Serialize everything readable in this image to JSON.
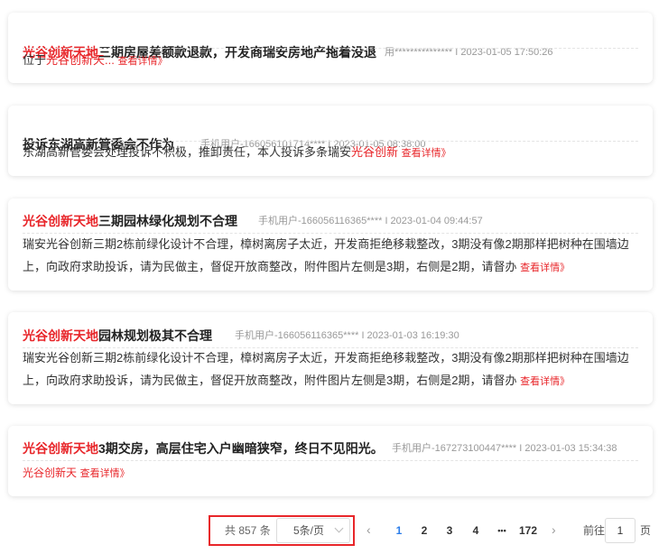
{
  "posts": [
    {
      "title_hl": "光谷创新天地",
      "title_rest": "三期房屋差额款退款，开发商瑞安房地产拖着没退",
      "meta": "用*************** I 2023-01-05 17:50:26",
      "body_text": "位于",
      "body_hl": "光谷创新天...",
      "more": "查看详情》"
    },
    {
      "title_hl": "",
      "title_rest": "投诉东湖高新管委会不作为",
      "meta": "手机用户-166056101714**** I 2023-01-05 08:38:00",
      "body_text": "东湖高新管委会处理投诉不积极，推卸责任，本人投诉多条瑞安",
      "body_hl": "光谷创新",
      "more": "查看详情》"
    },
    {
      "title_hl": "光谷创新天地",
      "title_rest": "三期园林绿化规划不合理",
      "meta": "手机用户-166056116365**** I 2023-01-04 09:44:57",
      "body_text": "瑞安光谷创新三期2栋前绿化设计不合理，樟树离房子太近，开发商拒绝移栽整改，3期没有像2期那样把树种在围墙边上，向政府求助投诉，请为民做主，督促开放商整改，附件图片左侧是3期，右侧是2期，请督办",
      "body_hl": "",
      "more": "查看详情》"
    },
    {
      "title_hl": "光谷创新天地",
      "title_rest": "园林规划极其不合理",
      "meta": "手机用户-166056116365**** I 2023-01-03 16:19:30",
      "body_text": "瑞安光谷创新三期2栋前绿化设计不合理，樟树离房子太近，开发商拒绝移栽整改，3期没有像2期那样把树种在围墙边上，向政府求助投诉，请为民做主，督促开放商整改，附件图片左侧是3期，右侧是2期，请督办",
      "body_hl": "",
      "more": "查看详情》"
    },
    {
      "title_hl": "光谷创新天地",
      "title_rest": "3期交房，高层住宅入户幽暗狭窄，终日不见阳光。",
      "meta": "手机用户-167273100447**** I 2023-01-03 15:34:38",
      "body_text": "",
      "body_hl": "光谷创新天",
      "more": "查看详情》"
    }
  ],
  "pagination": {
    "total": "共 857 条",
    "page_size": "5条/页",
    "prev": "‹",
    "pages": [
      "1",
      "2",
      "3",
      "4",
      "•••",
      "172"
    ],
    "next": "›",
    "goto_label": "前往",
    "goto_value": "1",
    "goto_suffix": "页",
    "active_color": "#2b7de9",
    "highlight_color": "#e8262a"
  }
}
